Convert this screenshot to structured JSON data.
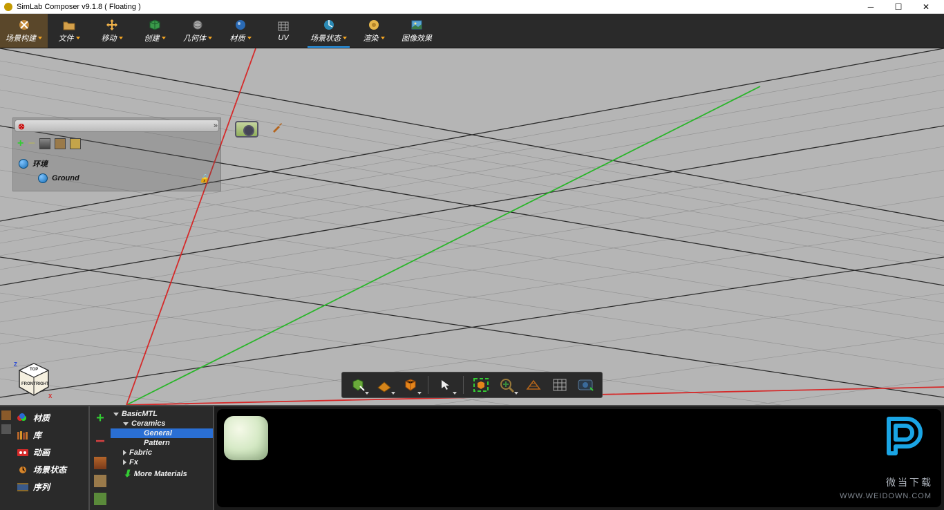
{
  "title": "SimLab Composer v9.1.8 ( Floating )",
  "toolbar": [
    {
      "id": "scene-build",
      "label": "场景构建",
      "active": true,
      "drop": true
    },
    {
      "id": "file",
      "label": "文件",
      "drop": true
    },
    {
      "id": "move",
      "label": "移动",
      "drop": true
    },
    {
      "id": "create",
      "label": "创建",
      "drop": true
    },
    {
      "id": "geometry",
      "label": "几何体",
      "drop": true
    },
    {
      "id": "material",
      "label": "材质",
      "drop": true
    },
    {
      "id": "uv",
      "label": "UV",
      "drop": false
    },
    {
      "id": "scene-state",
      "label": "场景状态",
      "drop": true,
      "underline": true
    },
    {
      "id": "render",
      "label": "渲染",
      "drop": true
    },
    {
      "id": "image-fx",
      "label": "图像效果",
      "drop": false
    }
  ],
  "scene_tree": {
    "env": "环境",
    "ground": "Ground"
  },
  "bottom_tabs": [
    {
      "id": "material",
      "label": "材质"
    },
    {
      "id": "library",
      "label": "库"
    },
    {
      "id": "animation",
      "label": "动画"
    },
    {
      "id": "scene-state",
      "label": "场景状态"
    },
    {
      "id": "sequence",
      "label": "序列"
    }
  ],
  "material_tree": {
    "root": "BasicMTL",
    "ceramics": "Ceramics",
    "general": "General",
    "pattern": "Pattern",
    "fabric": "Fabric",
    "fx": "Fx",
    "more": "More Materials"
  },
  "watermark": {
    "text": "微当下载",
    "url": "WWW.WEIDOWN.COM"
  }
}
